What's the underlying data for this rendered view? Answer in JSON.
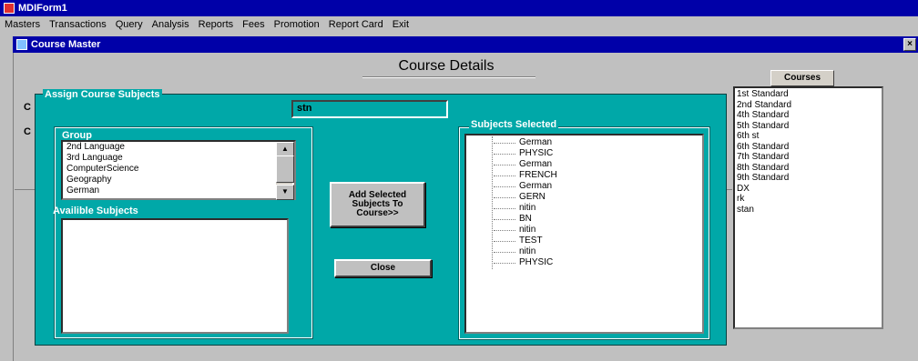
{
  "window": {
    "title": "MDIForm1"
  },
  "menu": [
    "Masters",
    "Transactions",
    "Query",
    "Analysis",
    "Reports",
    "Fees",
    "Promotion",
    "Report Card",
    "Exit"
  ],
  "child_window": {
    "title": "Course Master",
    "close_glyph": "×"
  },
  "page": {
    "title": "Course Details",
    "side_label_1": "C",
    "side_label_2": "C"
  },
  "assign": {
    "title": "Assign Course Subjects",
    "course_value": "stn",
    "group_label": "Group",
    "group_items": [
      "2nd Language",
      "3rd Language",
      "ComputerScience",
      "Geography",
      "German"
    ],
    "available_label": "Availible Subjects",
    "add_button": "Add Selected Subjects To Course>>",
    "close_button": "Close",
    "selected_label": "Subjects  Selected",
    "selected_items": [
      "German",
      "PHYSIC",
      "German",
      "FRENCH",
      "German",
      "GERN",
      "nitin",
      "BN",
      "nitin",
      "TEST",
      "nitin",
      "PHYSIC"
    ]
  },
  "courses": {
    "header": "Courses",
    "items": [
      "1st Standard",
      "2nd Standard",
      "4th Standard",
      "5th Standard",
      "6th st",
      "6th Standard",
      "7th Standard",
      "8th Standard",
      "9th Standard",
      "DX",
      "rk",
      "stan"
    ]
  },
  "colors": {
    "titlebar": "#0000a8",
    "dialog": "#00a8a8",
    "face": "#c0c0c0"
  }
}
